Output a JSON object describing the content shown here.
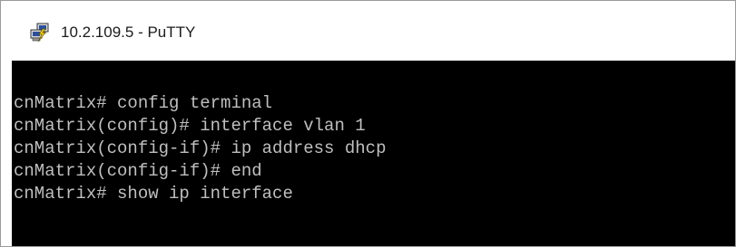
{
  "window": {
    "title": "10.2.109.5 - PuTTY",
    "icon": "putty-icon"
  },
  "terminal": {
    "background": "#000000",
    "foreground": "#bfbfbf",
    "lines": [
      "cnMatrix# config terminal",
      "cnMatrix(config)# interface vlan 1",
      "cnMatrix(config-if)# ip address dhcp",
      "cnMatrix(config-if)# end",
      "cnMatrix# show ip interface"
    ]
  }
}
